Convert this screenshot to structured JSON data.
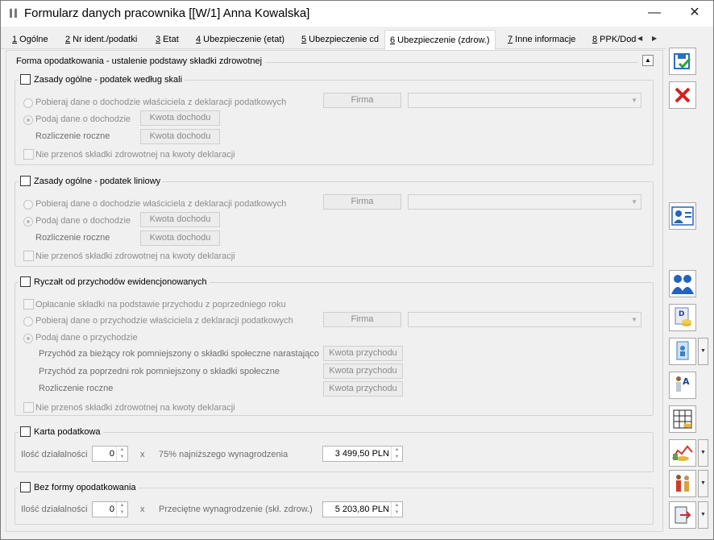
{
  "window": {
    "title": "Formularz danych pracownika [[W/1] Anna Kowalska]",
    "minimize": "—",
    "close": "✕"
  },
  "tabs": [
    {
      "key": "1",
      "label": " Ogólne"
    },
    {
      "key": "2",
      "label": " Nr ident./podatki"
    },
    {
      "key": "3",
      "label": " Etat"
    },
    {
      "key": "4",
      "label": " Ubezpieczenie (etat)"
    },
    {
      "key": "5",
      "label": " Ubezpieczenie cd"
    },
    {
      "key": "6",
      "label": " Ubezpieczenie (zdrow.)"
    },
    {
      "key": "7",
      "label": " Inne informacje"
    },
    {
      "key": "8",
      "label": " PPK/Dod"
    }
  ],
  "main": {
    "legend": "Forma opodatkowania - ustalenie podstawy składki zdrowotnej"
  },
  "skala": {
    "title": "Zasady ogólne - podatek według skali",
    "radio1": "Pobieraj dane o dochodzie właściciela z deklaracji podatkowych",
    "firma": "Firma",
    "radio2": "Podaj dane o dochodzie",
    "kwota_dochodu": "Kwota dochodu",
    "rozliczenie": "Rozliczenie roczne",
    "kwota_dochodu2": "Kwota dochodu",
    "nie_przenos": "Nie przenoś składki zdrowotnej na kwoty deklaracji"
  },
  "liniowy": {
    "title": "Zasady ogólne - podatek liniowy",
    "radio1": "Pobieraj dane o dochodzie właściciela z deklaracji podatkowych",
    "firma": "Firma",
    "radio2": "Podaj dane o dochodzie",
    "kwota_dochodu": "Kwota dochodu",
    "rozliczenie": "Rozliczenie roczne",
    "kwota_dochodu2": "Kwota dochodu",
    "nie_przenos": "Nie przenoś składki zdrowotnej na kwoty deklaracji"
  },
  "ryczalt": {
    "title": "Ryczałt od przychodów ewidencjonowanych",
    "oplacanie": "Opłacanie składki na podstawie przychodu z poprzedniego roku",
    "radio1": "Pobieraj dane o przychodzie właściciela z deklaracji podatkowych",
    "firma": "Firma",
    "radio2": "Podaj dane o przychodzie",
    "row1": "Przychód za bieżący rok pomniejszony o składki społeczne narastająco",
    "row2": "Przychód za poprzedni rok pomniejszony o składki społeczne",
    "row3": "Rozliczenie roczne",
    "kwota_przychodu": "Kwota przychodu",
    "nie_przenos": "Nie przenoś składki zdrowotnej na kwoty deklaracji"
  },
  "karta": {
    "title": "Karta podatkowa",
    "ilosc_label": "Ilość działalności",
    "ilosc_value": "0",
    "x": "x",
    "desc": "75% najniższego wynagrodzenia",
    "amount": "3 499,50 PLN"
  },
  "bez": {
    "title": "Bez formy opodatkowania",
    "ilosc_label": "Ilość działalności",
    "ilosc_value": "0",
    "x": "x",
    "desc": "Przeciętne wynagrodzenie (skł. zdrow.)",
    "amount": "5 203,80 PLN"
  },
  "colors": {
    "save": "#2e6fb8",
    "cancel": "#d42020",
    "people": "#2563b8"
  }
}
